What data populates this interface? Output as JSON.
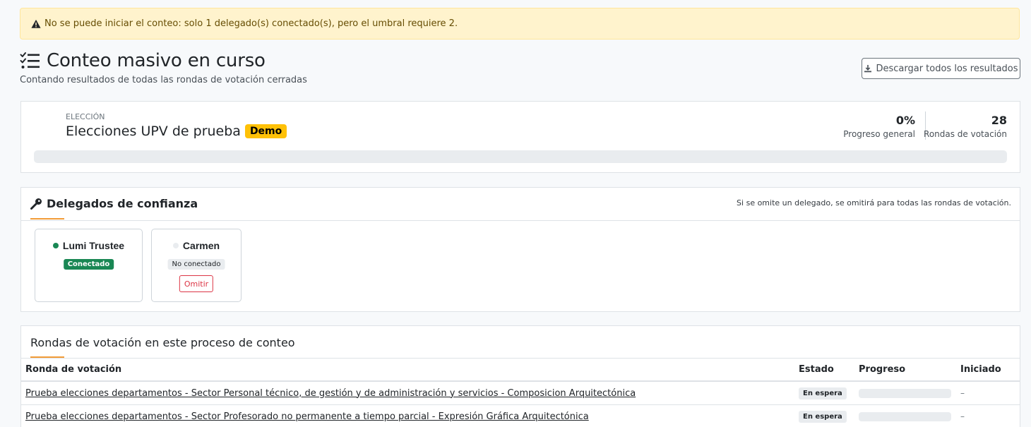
{
  "alert": {
    "message": "No se puede iniciar el conteo: solo 1 delegado(s) conectado(s), pero el umbral requiere 2.",
    "color": "#fff3cd"
  },
  "header": {
    "title": "Conteo masivo en curso",
    "subtitle": "Contando resultados de todas las rondas de votación cerradas",
    "download_label": "Descargar todos los resultados",
    "title_icon": "list-check-icon",
    "download_icon": "download-icon"
  },
  "election": {
    "label": "ELECCIÓN",
    "name": "Elecciones UPV de prueba",
    "badge": "Demo",
    "badge_color": "#ffc107",
    "progress_value": "0%",
    "progress_label": "Progreso general",
    "progress_fraction": 0,
    "rounds_value": "28",
    "rounds_label": "Rondas de votación"
  },
  "trustees": {
    "title": "Delegados de confianza",
    "icon": "key-icon",
    "note": "Si se omite un delegado, se omitirá para todas las rondas de votación.",
    "items": [
      {
        "name": "Lumi Trustee",
        "status": "Conectado",
        "online": true
      },
      {
        "name": "Carmen",
        "status": "No conectado",
        "online": false,
        "omit_label": "Omitir"
      }
    ],
    "accent_color": "#f29c38",
    "online_color": "#198754",
    "danger_color": "#dc3545"
  },
  "rounds": {
    "title": "Rondas de votación en este proceso de conteo",
    "columns": [
      "Ronda de votación",
      "Estado",
      "Progreso",
      "Iniciado"
    ],
    "rows": [
      {
        "name": "Prueba elecciones departamentos - Sector Personal técnico, de gestión y de administración y servicios - Composicion Arquitectónica",
        "state": "En espera",
        "progress_fraction": 0,
        "started": "–"
      },
      {
        "name": "Prueba elecciones departamentos - Sector Profesorado no permanente a tiempo parcial - Expresión Gráfica Arquitectónica",
        "state": "En espera",
        "progress_fraction": 0,
        "started": "–"
      }
    ]
  }
}
